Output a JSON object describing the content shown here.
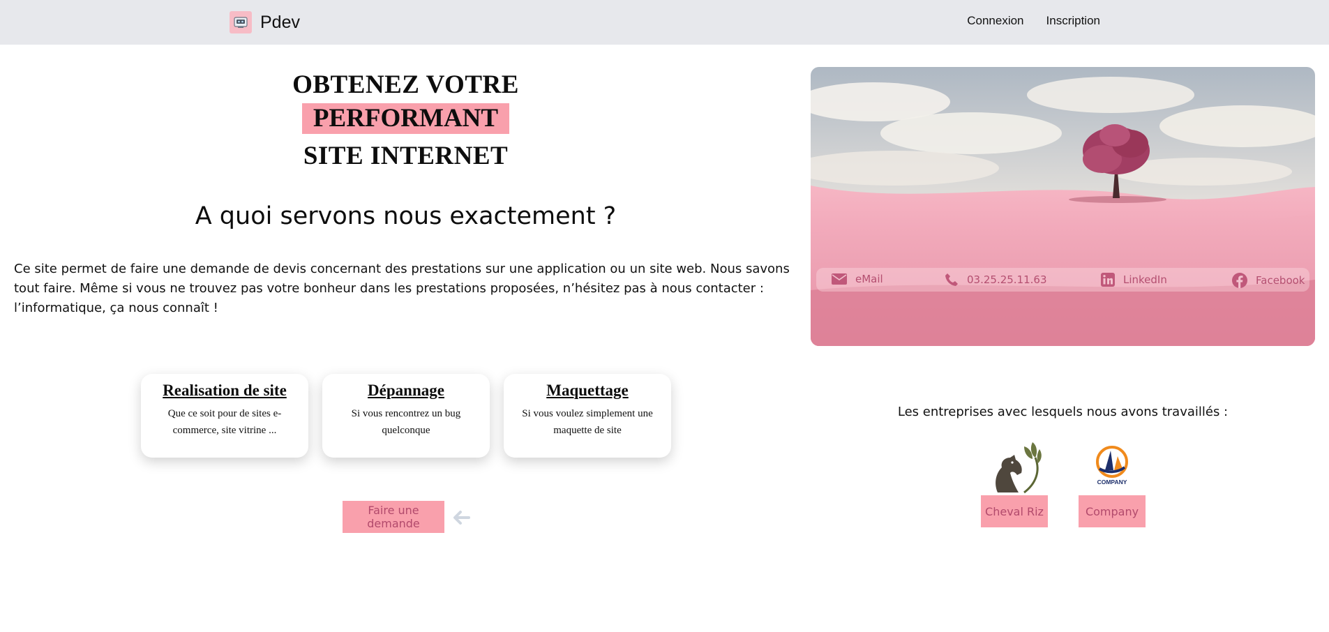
{
  "navbar": {
    "brand": "Pdev",
    "links": [
      {
        "label": "Connexion"
      },
      {
        "label": "Inscription"
      }
    ]
  },
  "hero": {
    "line1": "OBTENEZ VOTRE",
    "highlight": "PERFORMANT",
    "line3": "SITE INTERNET"
  },
  "subtitle": "A quoi servons nous exactement ?",
  "intro": "Ce site permet de faire une demande de devis concernant des prestations sur une application ou un site web. Nous savons tout faire. Même si vous ne trouvez pas votre bonheur dans les prestations proposées, n’hésitez pas à nous contacter : l’informatique, ça nous connaît !",
  "services": [
    {
      "title": "Realisation de site",
      "text": "Que ce soit pour de sites e-commerce, site vitrine ..."
    },
    {
      "title": "Dépannage",
      "text": "Si vous rencontrez un bug quelconque"
    },
    {
      "title": "Maquettage",
      "text": "Si vous voulez simplement une maquette de site"
    }
  ],
  "cta": "Faire une demande",
  "contacts": [
    {
      "label": "eMail",
      "icon": "envelope-icon"
    },
    {
      "label": "03.25.25.11.63",
      "icon": "phone-icon"
    },
    {
      "label": "LinkedIn",
      "icon": "linkedin-icon"
    },
    {
      "label": "Facebook",
      "icon": "facebook-icon"
    }
  ],
  "partners": {
    "title": "Les entreprises avec lesquels nous avons travaillés :",
    "items": [
      {
        "name": "Cheval Riz"
      },
      {
        "name": "Company",
        "logo_text": "COMPANY"
      }
    ]
  },
  "colors": {
    "accent_pink": "#f9a0ac",
    "button_text": "#b24a6c",
    "navbar_bg": "#e7e8ec"
  }
}
